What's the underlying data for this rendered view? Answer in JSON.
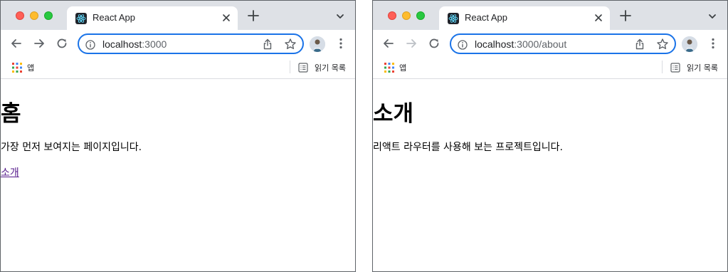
{
  "windows": [
    {
      "tab": {
        "title": "React App"
      },
      "address_bar": {
        "host": "localhost",
        "path": ":3000"
      },
      "bookmarks": {
        "apps_label": "앱",
        "reading_list_label": "읽기 목록"
      },
      "page": {
        "heading": "홈",
        "text": "가장 먼저 보여지는 페이지입니다.",
        "link": "소개"
      }
    },
    {
      "tab": {
        "title": "React App"
      },
      "address_bar": {
        "host": "localhost",
        "path": ":3000/about"
      },
      "bookmarks": {
        "apps_label": "앱",
        "reading_list_label": "읽기 목록"
      },
      "page": {
        "heading": "소개",
        "text": "리액트 라우터를 사용해 보는 프로젝트입니다."
      }
    }
  ],
  "icons": {
    "favicon": "react-logo-icon",
    "close": "close-icon",
    "new_tab": "plus-icon",
    "tab_search": "chevron-down-icon",
    "back": "arrow-left-icon",
    "forward": "arrow-right-icon",
    "reload": "reload-icon",
    "info": "info-icon",
    "share": "share-icon",
    "bookmark": "star-icon",
    "profile": "avatar",
    "menu": "kebab-menu-icon",
    "apps": "apps-grid-icon",
    "reading_list": "reading-list-icon"
  },
  "colors": {
    "tabstrip_bg": "#dee1e6",
    "omnibox_focus": "#1a73e8",
    "visited_link": "#551a8b",
    "traffic_red": "#ff5f57",
    "traffic_yellow": "#febc2e",
    "traffic_green": "#28c840"
  }
}
